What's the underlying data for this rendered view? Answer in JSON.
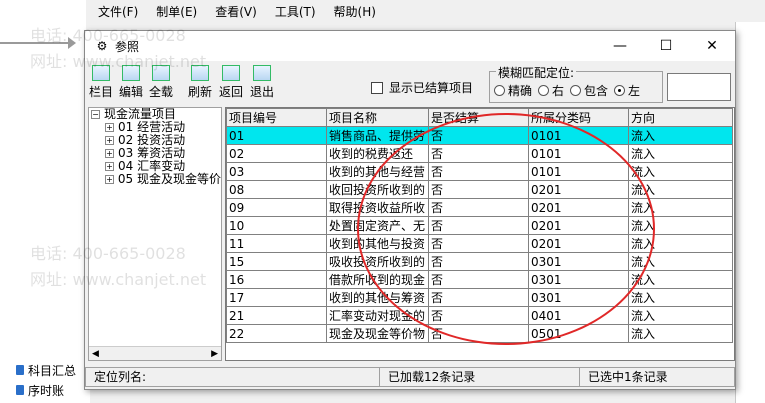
{
  "background": {
    "menu": [
      "文件(F)",
      "制单(E)",
      "查看(V)",
      "工具(T)",
      "帮助(H)"
    ],
    "bottom_items": [
      "科目汇总",
      "序时账"
    ]
  },
  "dialog": {
    "title": "参照",
    "close_glyph": "✕",
    "maximize_glyph": "☐",
    "minimize_glyph": "—",
    "toolbar": {
      "column_label": "栏目",
      "edit_label": "编辑",
      "selectall_label": "全载",
      "refresh_label": "刷新",
      "back_label": "返回",
      "exit_label": "退出"
    },
    "show_settled_label": "显示已结算项目",
    "fuzzy": {
      "legend": "模糊匹配定位:",
      "options": [
        "精确",
        "右",
        "包含",
        "左"
      ],
      "selected": "左"
    },
    "tree": {
      "root": "现金流量项目",
      "children": [
        "01 经营活动",
        "02 投资活动",
        "03 筹资活动",
        "04 汇率变动",
        "05 现金及现金等价"
      ]
    },
    "grid": {
      "headers": [
        "项目编号",
        "项目名称",
        "是否结算",
        "所属分类码",
        "方向"
      ],
      "rows": [
        [
          "01",
          "销售商品、提供劳",
          "否",
          "0101",
          "流入"
        ],
        [
          "02",
          "收到的税费返还",
          "否",
          "0101",
          "流入"
        ],
        [
          "03",
          "收到的其他与经营",
          "否",
          "0101",
          "流入"
        ],
        [
          "08",
          "收回投资所收到的",
          "否",
          "0201",
          "流入"
        ],
        [
          "09",
          "取得投资收益所收",
          "否",
          "0201",
          "流入"
        ],
        [
          "10",
          "处置固定资产、无",
          "否",
          "0201",
          "流入"
        ],
        [
          "11",
          "收到的其他与投资",
          "否",
          "0201",
          "流入"
        ],
        [
          "15",
          "吸收投资所收到的",
          "否",
          "0301",
          "流入"
        ],
        [
          "16",
          "借款所收到的现金",
          "否",
          "0301",
          "流入"
        ],
        [
          "17",
          "收到的其他与筹资",
          "否",
          "0301",
          "流入"
        ],
        [
          "21",
          "汇率变动对现金的",
          "否",
          "0401",
          "流入"
        ],
        [
          "22",
          "现金及现金等价物",
          "否",
          "0501",
          "流入"
        ]
      ]
    },
    "status": {
      "locate_label": "定位列名:",
      "loaded": "已加载12条记录",
      "selected": "已选中1条记录"
    }
  },
  "watermarks": [
    "电话: 400-665-0028",
    "网址: www.chanjet.net"
  ],
  "colors": {
    "selected_row": "#00e6ee",
    "annotation_circle": "#e02828"
  }
}
